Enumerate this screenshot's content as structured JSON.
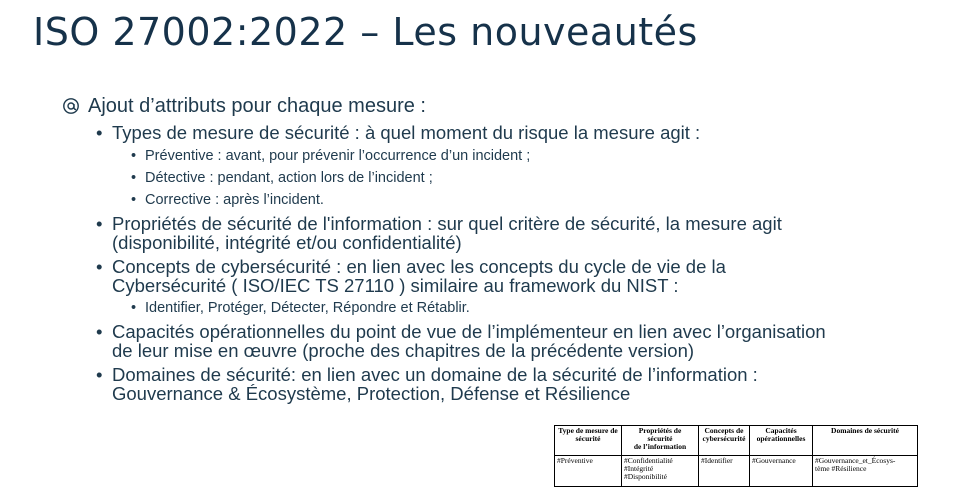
{
  "title": "ISO 27002:2022 – Les nouveautés",
  "main_bullet": {
    "icon": "at-sign-icon",
    "text": "Ajout d’attributs pour chaque mesure :"
  },
  "items": {
    "types": {
      "text": "Types de mesure de sécurité : à quel moment du risque la mesure agit :",
      "sub": [
        "Préventive : avant, pour prévenir l’occurrence d’un incident ;",
        "Détective : pendant, action lors de l’incident ;",
        "Corrective : après l’incident."
      ]
    },
    "proprietes": {
      "line1": "Propriétés de sécurité de l'information : sur quel critère de sécurité, la mesure agit",
      "line2": "(disponibilité, intégrité et/ou confidentialité)"
    },
    "concepts": {
      "line1": "Concepts de cybersécurité : en lien avec les concepts du cycle de vie de la",
      "line2": "Cybersécurité ( ISO/IEC TS 27110 ) similaire au framework du NIST :",
      "sub": [
        "Identifier, Protéger, Détecter, Répondre et Rétablir."
      ]
    },
    "capacites": {
      "line1": "Capacités opérationnelles du point de vue de l’implémenteur en lien avec l’organisation",
      "line2": "de leur mise en œuvre (proche des chapitres de la précédente version)"
    },
    "domaines": {
      "line1": "Domaines de sécurité: en lien avec un domaine de la sécurité de l’information :",
      "line2": "Gouvernance & Écosystème,  Protection, Défense et Résilience"
    }
  },
  "table": {
    "headers": {
      "type": [
        "Type de mesure de",
        "sécurité"
      ],
      "proprietes": [
        "Propriétés de",
        "sécurité",
        "de l’information"
      ],
      "concepts": [
        "Concepts de",
        "cybersécurité"
      ],
      "capacites": [
        "Capacités",
        "opérationnelles"
      ],
      "domaines": [
        "Domaines de sécurité"
      ]
    },
    "row": {
      "type": [
        "#Préventive"
      ],
      "proprietes": [
        "#Confidentialité",
        "#Intégrité",
        "#Disponibilité"
      ],
      "concepts": [
        "#Identifier"
      ],
      "capacites": [
        "#Gouvernance"
      ],
      "domaines": [
        "#Gouvernance_et_Écosys-",
        "tème #Résilience"
      ]
    }
  }
}
